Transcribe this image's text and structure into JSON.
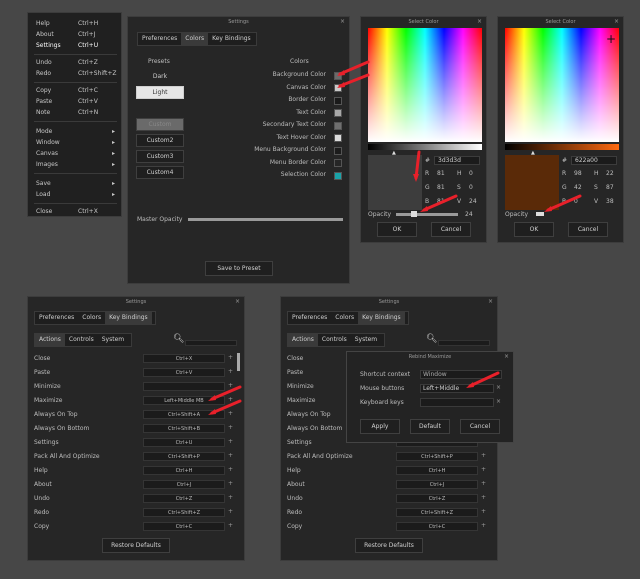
{
  "menu": {
    "items": [
      {
        "label": "Help",
        "shortcut": "Ctrl+H"
      },
      {
        "label": "About",
        "shortcut": "Ctrl+J"
      },
      {
        "label": "Settings",
        "shortcut": "Ctrl+U"
      },
      {
        "label": "Undo",
        "shortcut": "Ctrl+Z"
      },
      {
        "label": "Redo",
        "shortcut": "Ctrl+Shift+Z"
      },
      {
        "label": "Copy",
        "shortcut": "Ctrl+C"
      },
      {
        "label": "Paste",
        "shortcut": "Ctrl+V"
      },
      {
        "label": "Note",
        "shortcut": "Ctrl+N"
      },
      {
        "label": "Mode",
        "arrow": "▸"
      },
      {
        "label": "Window",
        "arrow": "▸"
      },
      {
        "label": "Canvas",
        "arrow": "▸"
      },
      {
        "label": "Images",
        "arrow": "▸"
      },
      {
        "label": "Save",
        "arrow": "▸"
      },
      {
        "label": "Load",
        "arrow": "▸"
      },
      {
        "label": "Close",
        "shortcut": "Ctrl+X"
      }
    ]
  },
  "settings_colors": {
    "title": "Settings",
    "close": "×",
    "tabs": [
      "Preferences",
      "Colors",
      "Key Bindings"
    ],
    "presets_label": "Presets",
    "presets": [
      "Dark",
      "Light",
      "Custom",
      "Custom2",
      "Custom3",
      "Custom4"
    ],
    "colors_label": "Colors",
    "color_items": [
      {
        "label": "Background Color",
        "color": "#6a6a6a"
      },
      {
        "label": "Canvas Color",
        "color": "#c9c9c9"
      },
      {
        "label": "Border Color",
        "color": "#1a1a1a"
      },
      {
        "label": "Text Color",
        "color": "#a8a8a8"
      },
      {
        "label": "Secondary Text Color",
        "color": "#6f6f6f"
      },
      {
        "label": "Text Hover Color",
        "color": "#dcdcdc"
      },
      {
        "label": "Menu Background Color",
        "color": "#1c1c1c"
      },
      {
        "label": "Menu Border Color",
        "color": "#262626"
      },
      {
        "label": "Selection Color",
        "color": "#1aa3a8"
      }
    ],
    "opacity_label": "Master Opacity",
    "save_label": "Save to Preset"
  },
  "picker1": {
    "title": "Select Color",
    "close": "×",
    "hex": "3d3d3d",
    "r": "81",
    "h": "0",
    "g": "81",
    "s": "0",
    "b": "81",
    "v": "24",
    "opacity_label": "Opacity",
    "opacity_value": "24",
    "ok": "OK",
    "cancel": "Cancel",
    "preview_color": "#3d3d3d"
  },
  "picker2": {
    "title": "Select Color",
    "close": "×",
    "hex": "622a00",
    "r": "98",
    "h": "22",
    "g": "42",
    "s": "87",
    "b": "0",
    "v": "38",
    "opacity_label": "Opacity",
    "ok": "OK",
    "cancel": "Cancel",
    "preview_color": "#5a2a08"
  },
  "keybind1": {
    "title": "Settings",
    "close": "×",
    "tabs": [
      "Preferences",
      "Colors",
      "Key Bindings"
    ],
    "subtabs": [
      "Actions",
      "Controls",
      "System"
    ],
    "rows": [
      {
        "label": "Close",
        "key": "Ctrl+X"
      },
      {
        "label": "Paste",
        "key": "Ctrl+V"
      },
      {
        "label": "Minimize",
        "key": ""
      },
      {
        "label": "Maximize",
        "key": "Left+Middle MB"
      },
      {
        "label": "Always On Top",
        "key": "Ctrl+Shift+A"
      },
      {
        "label": "Always On Bottom",
        "key": "Ctrl+Shift+B"
      },
      {
        "label": "Settings",
        "key": "Ctrl+U"
      },
      {
        "label": "Pack All And Optimize",
        "key": "Ctrl+Shift+P"
      },
      {
        "label": "Help",
        "key": "Ctrl+H"
      },
      {
        "label": "About",
        "key": "Ctrl+J"
      },
      {
        "label": "Undo",
        "key": "Ctrl+Z"
      },
      {
        "label": "Redo",
        "key": "Ctrl+Shift+Z"
      },
      {
        "label": "Copy",
        "key": "Ctrl+C"
      }
    ],
    "restore": "Restore Defaults"
  },
  "keybind2": {
    "title": "Settings",
    "close": "×",
    "tabs": [
      "Preferences",
      "Colors",
      "Key Bindings"
    ],
    "subtabs": [
      "Actions",
      "Controls",
      "System"
    ],
    "rows": [
      {
        "label": "Close",
        "key": "Ctrl+X"
      },
      {
        "label": "Paste",
        "key": "Ctrl+V"
      },
      {
        "label": "Minimize",
        "key": ""
      },
      {
        "label": "Maximize",
        "key": ""
      },
      {
        "label": "Always On Top",
        "key": ""
      },
      {
        "label": "Always On Bottom",
        "key": ""
      },
      {
        "label": "Settings",
        "key": ""
      },
      {
        "label": "Pack All And Optimize",
        "key": "Ctrl+Shift+P"
      },
      {
        "label": "Help",
        "key": "Ctrl+H"
      },
      {
        "label": "About",
        "key": "Ctrl+J"
      },
      {
        "label": "Undo",
        "key": "Ctrl+Z"
      },
      {
        "label": "Redo",
        "key": "Ctrl+Shift+Z"
      },
      {
        "label": "Copy",
        "key": "Ctrl+C"
      }
    ],
    "restore": "Restore Defaults"
  },
  "rebind": {
    "title": "Rebind Maximize",
    "close": "×",
    "context_label": "Shortcut context",
    "context_value": "Window",
    "mouse_label": "Mouse buttons",
    "mouse_value": "Left+Middle",
    "keyboard_label": "Keyboard keys",
    "apply": "Apply",
    "default": "Default",
    "cancel": "Cancel"
  },
  "colors": {
    "arrow": "#e8202a",
    "selection": "#1aa3a8"
  }
}
